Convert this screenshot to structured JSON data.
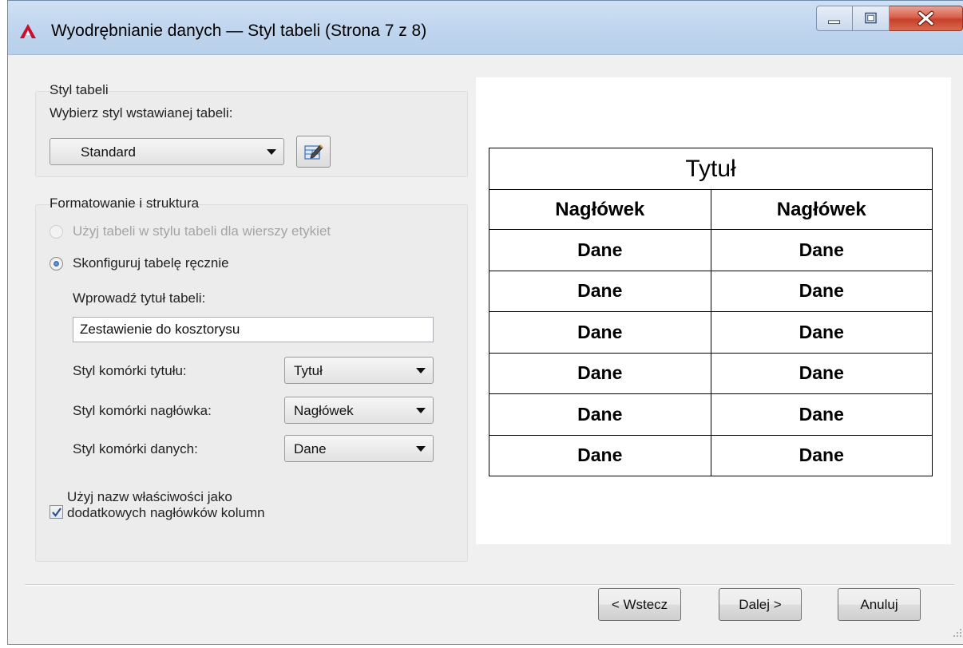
{
  "window": {
    "title": "Wyodrębnianie danych — Styl tabeli (Strona 7 z 8)",
    "icons": [
      "autocad-app-icon",
      "minimize-icon",
      "maximize-icon",
      "close-icon"
    ]
  },
  "table_style": {
    "group_label": "Styl tabeli",
    "select_label": "Wybierz styl wstawianej tabeli:",
    "selected": "Standard"
  },
  "formatting": {
    "group_label": "Formatowanie i struktura",
    "radio_use_table": "Użyj tabeli w stylu tabeli dla wierszy etykiet",
    "radio_manual": "Skonfiguruj tabelę ręcznie",
    "title_label": "Wprowadź tytuł tabeli:",
    "title_value": "Zestawienie do kosztorysu",
    "title_cell_label": "Styl komórki tytułu:",
    "title_cell_value": "Tytuł",
    "header_cell_label": "Styl komórki nagłówka:",
    "header_cell_value": "Nagłówek",
    "data_cell_label": "Styl komórki danych:",
    "data_cell_value": "Dane",
    "checkbox_line1": "Użyj nazw właściwości jako",
    "checkbox_line2": "dodatkowych nagłówków kolumn",
    "checkbox_checked": true
  },
  "preview": {
    "title": "Tytuł",
    "headers": [
      "Nagłówek",
      "Nagłówek"
    ],
    "rows": [
      [
        "Dane",
        "Dane"
      ],
      [
        "Dane",
        "Dane"
      ],
      [
        "Dane",
        "Dane"
      ],
      [
        "Dane",
        "Dane"
      ],
      [
        "Dane",
        "Dane"
      ],
      [
        "Dane",
        "Dane"
      ]
    ]
  },
  "buttons": {
    "back": "< Wstecz",
    "next": "Dalej >",
    "cancel": "Anuluj"
  },
  "colors": {
    "accent": "#1c4e9e",
    "titlebar": "#c0d6ef",
    "close_button": "#c7402c",
    "app_icon": "#c8102e"
  }
}
